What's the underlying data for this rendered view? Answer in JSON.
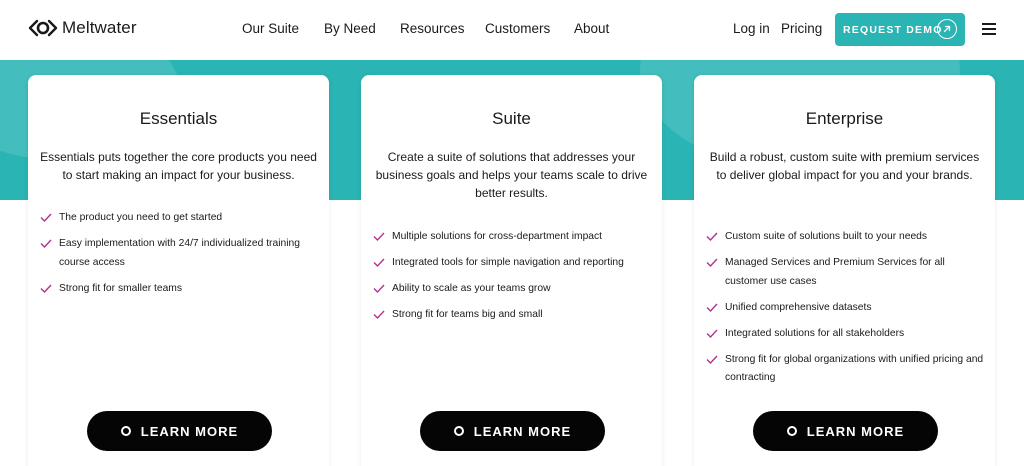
{
  "header": {
    "logo_text": "Meltwater",
    "nav": [
      "Our Suite",
      "By Need",
      "Resources",
      "Customers",
      "About"
    ],
    "login": "Log in",
    "pricing": "Pricing",
    "demo_label": "REQUEST DEMO"
  },
  "colors": {
    "accent": "#2ab4b4",
    "check": "#b0338f",
    "button": "#050505"
  },
  "cards": [
    {
      "title": "Essentials",
      "description": "Essentials puts together the core products you need to start making an impact for your business.",
      "features": [
        "The product you need to get started",
        "Easy implementation with 24/7 individualized training course access",
        "Strong fit for smaller teams"
      ],
      "button": "LEARN MORE"
    },
    {
      "title": "Suite",
      "description": "Create a suite of solutions that addresses your business goals and helps your teams scale to drive better results.",
      "features": [
        "Multiple solutions for cross-department impact",
        "Integrated tools for simple navigation and reporting",
        "Ability to scale as your teams grow",
        "Strong fit for teams big and small"
      ],
      "button": "LEARN MORE"
    },
    {
      "title": "Enterprise",
      "description": "Build a robust, custom suite with premium services to deliver global impact for you and your brands.",
      "features": [
        "Custom suite of solutions built to your needs",
        "Managed Services and Premium Services for all customer use cases",
        "Unified comprehensive datasets",
        "Integrated solutions for all stakeholders",
        "Strong fit for global organizations with unified pricing and contracting"
      ],
      "button": "LEARN MORE"
    }
  ]
}
